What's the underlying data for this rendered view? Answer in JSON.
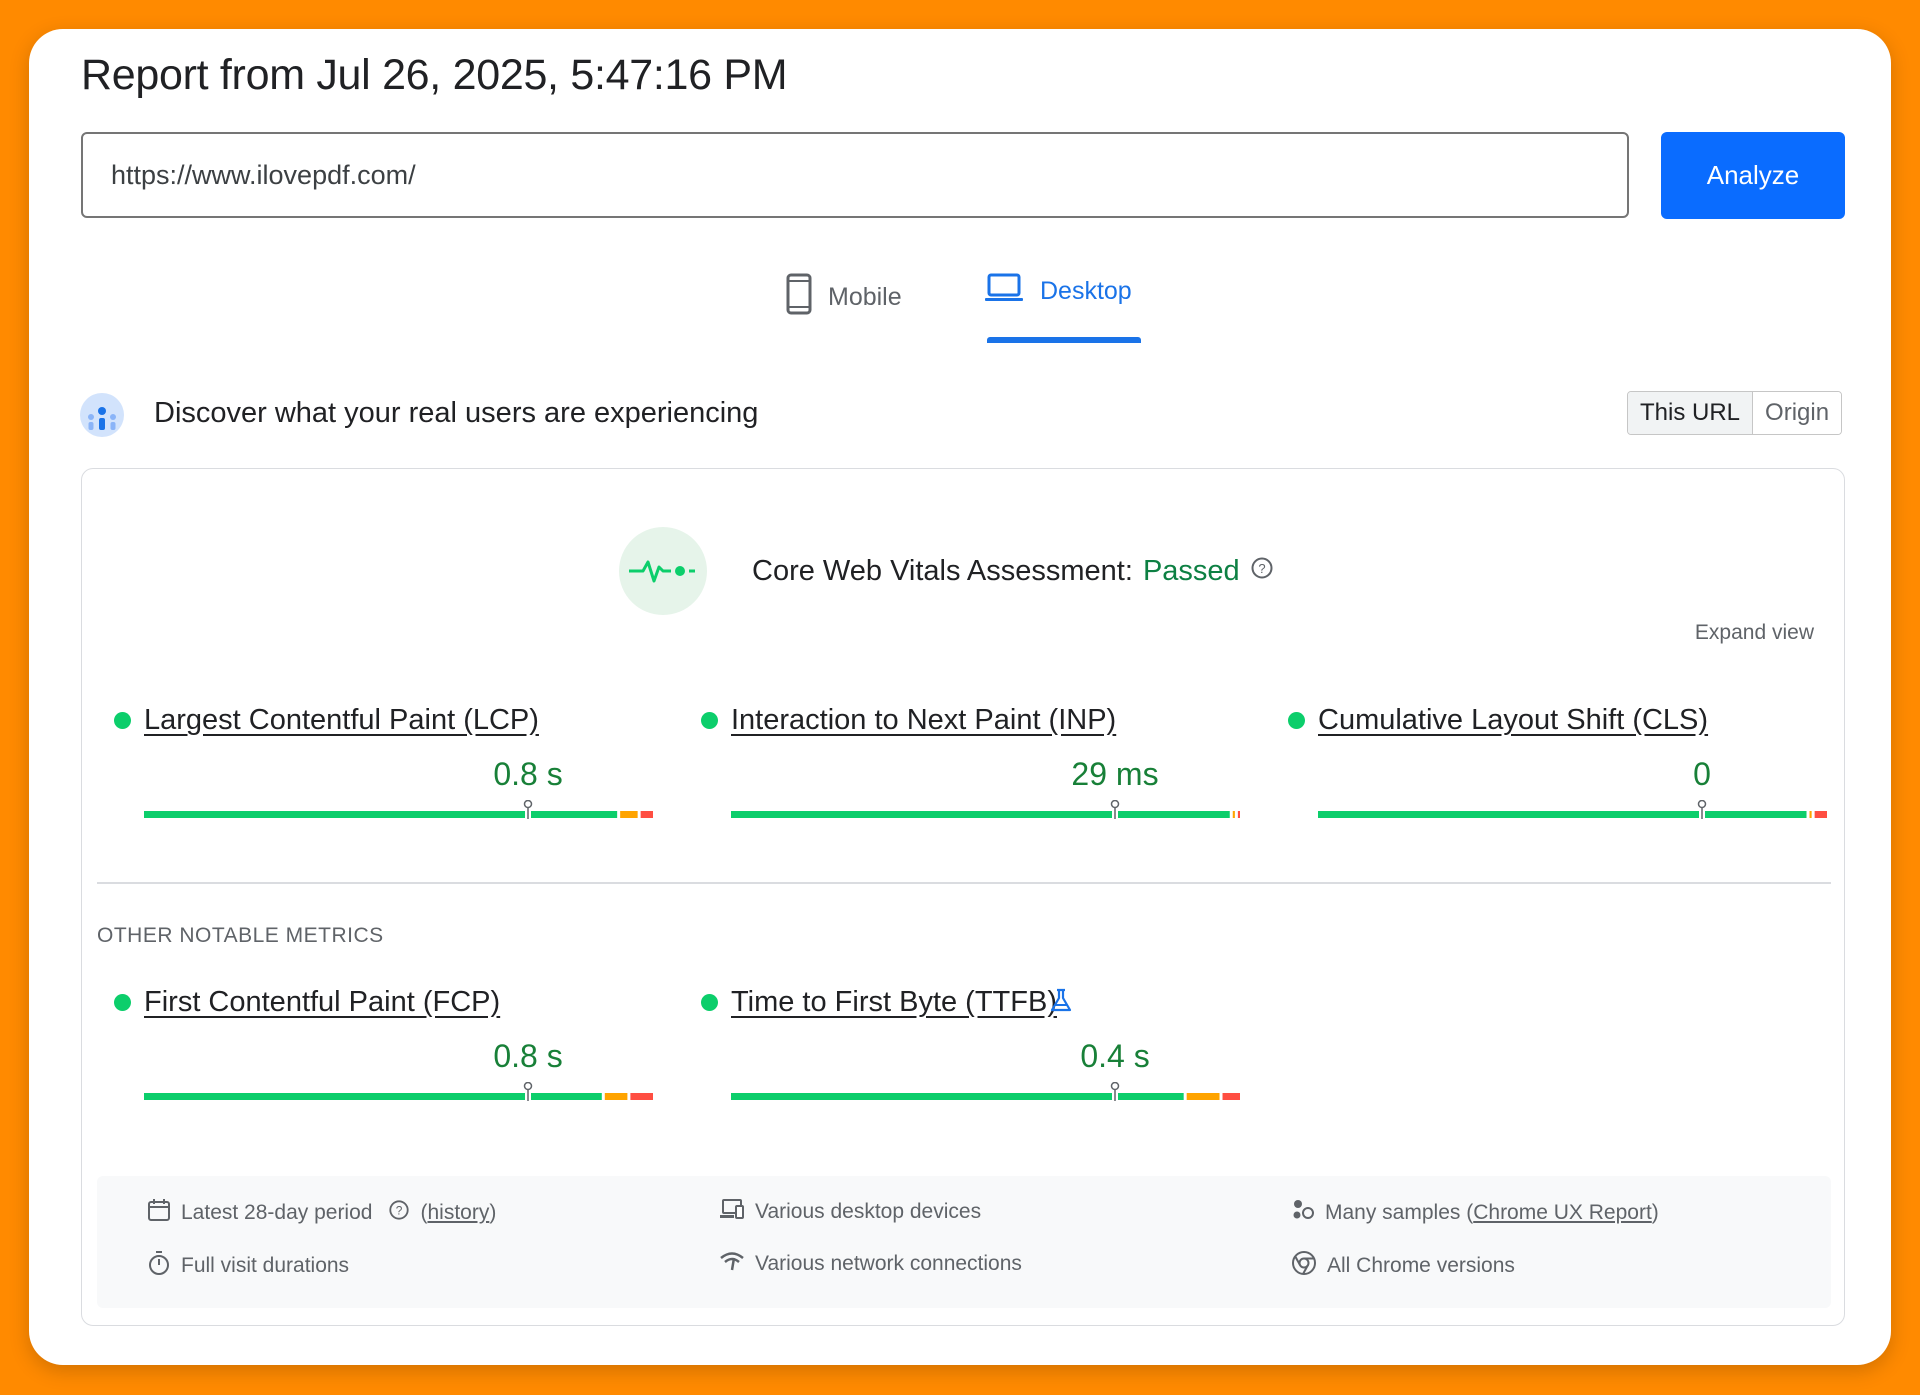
{
  "report": {
    "title": "Report from Jul 26, 2025, 5:47:16 PM"
  },
  "url_input": {
    "value": "https://www.ilovepdf.com/",
    "analyze_label": "Analyze"
  },
  "tabs": {
    "mobile": "Mobile",
    "desktop": "Desktop",
    "active": "Desktop"
  },
  "crux": {
    "heading": "Discover what your real users are experiencing",
    "toggle": {
      "this_url": "This URL",
      "origin": "Origin",
      "active": "This URL"
    }
  },
  "assessment": {
    "label": "Core Web Vitals Assessment:",
    "status": "Passed",
    "expand_label": "Expand view"
  },
  "core_metrics": [
    {
      "name": "Largest Contentful Paint (LCP)",
      "value": "0.8 s",
      "status": "good",
      "distribution": [
        0.93,
        0.04,
        0.03
      ]
    },
    {
      "name": "Interaction to Next Paint (INP)",
      "value": "29 ms",
      "status": "good",
      "distribution": [
        0.98,
        0.01,
        0.01
      ]
    },
    {
      "name": "Cumulative Layout Shift (CLS)",
      "value": "0",
      "status": "good",
      "distribution": [
        0.96,
        0.01,
        0.03
      ]
    }
  ],
  "other_metrics_label": "OTHER NOTABLE METRICS",
  "other_metrics": [
    {
      "name": "First Contentful Paint (FCP)",
      "value": "0.8 s",
      "status": "good",
      "distribution": [
        0.9,
        0.05,
        0.05
      ],
      "experimental": false
    },
    {
      "name": "Time to First Byte (TTFB)",
      "value": "0.4 s",
      "status": "good",
      "distribution": [
        0.89,
        0.07,
        0.04
      ],
      "experimental": true
    }
  ],
  "info": {
    "period_text": "Latest 28-day period",
    "history_link": "history",
    "durations": "Full visit durations",
    "devices": "Various desktop devices",
    "network": "Various network connections",
    "samples_text": "Many samples",
    "samples_link": "Chrome UX Report",
    "chrome_versions": "All Chrome versions"
  },
  "colors": {
    "good": "#0cce6b",
    "needs_improvement": "#ffa400",
    "poor": "#ff4e42",
    "accent": "#1a73e8",
    "background": "#ff8a00"
  },
  "icons": [
    "mobile-phone-icon",
    "laptop-icon",
    "crux-people-icon",
    "heartbeat-icon",
    "help-icon",
    "flask-icon",
    "calendar-icon",
    "stopwatch-icon",
    "devices-icon",
    "wifi-signal-icon",
    "samples-icon",
    "chrome-icon"
  ]
}
